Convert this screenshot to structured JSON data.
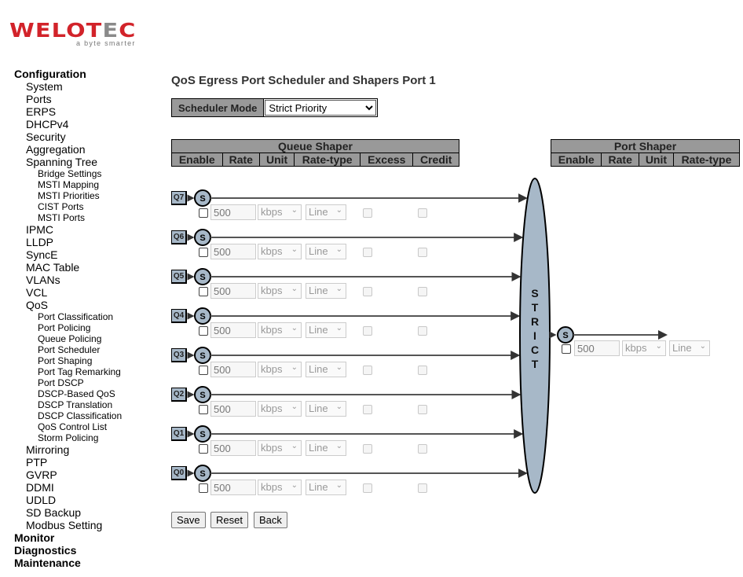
{
  "logo": {
    "brand_main": "WELOT",
    "brand_mid": "E",
    "brand_end": "C",
    "tagline": "a byte smarter"
  },
  "nav": [
    {
      "label": "Configuration",
      "level": 0
    },
    {
      "label": "System",
      "level": 1
    },
    {
      "label": "Ports",
      "level": 1
    },
    {
      "label": "ERPS",
      "level": 1
    },
    {
      "label": "DHCPv4",
      "level": 1
    },
    {
      "label": "Security",
      "level": 1
    },
    {
      "label": "Aggregation",
      "level": 1
    },
    {
      "label": "Spanning Tree",
      "level": 1
    },
    {
      "label": "Bridge Settings",
      "level": 2
    },
    {
      "label": "MSTI Mapping",
      "level": 2
    },
    {
      "label": "MSTI Priorities",
      "level": 2
    },
    {
      "label": "CIST Ports",
      "level": 2
    },
    {
      "label": "MSTI Ports",
      "level": 2
    },
    {
      "label": "IPMC",
      "level": 1
    },
    {
      "label": "LLDP",
      "level": 1
    },
    {
      "label": "SyncE",
      "level": 1
    },
    {
      "label": "MAC Table",
      "level": 1
    },
    {
      "label": "VLANs",
      "level": 1
    },
    {
      "label": "VCL",
      "level": 1
    },
    {
      "label": "QoS",
      "level": 1
    },
    {
      "label": "Port Classification",
      "level": 2
    },
    {
      "label": "Port Policing",
      "level": 2
    },
    {
      "label": "Queue Policing",
      "level": 2
    },
    {
      "label": "Port Scheduler",
      "level": 2
    },
    {
      "label": "Port Shaping",
      "level": 2
    },
    {
      "label": "Port Tag Remarking",
      "level": 2
    },
    {
      "label": "Port DSCP",
      "level": 2
    },
    {
      "label": "DSCP-Based QoS",
      "level": 2
    },
    {
      "label": "DSCP Translation",
      "level": 2
    },
    {
      "label": "DSCP Classification",
      "level": 2
    },
    {
      "label": "QoS Control List",
      "level": 2
    },
    {
      "label": "Storm Policing",
      "level": 2
    },
    {
      "label": "Mirroring",
      "level": 1
    },
    {
      "label": "PTP",
      "level": 1
    },
    {
      "label": "GVRP",
      "level": 1
    },
    {
      "label": "DDMI",
      "level": 1
    },
    {
      "label": "UDLD",
      "level": 1
    },
    {
      "label": "SD Backup",
      "level": 1
    },
    {
      "label": "Modbus Setting",
      "level": 1
    },
    {
      "label": "Monitor",
      "level": 0
    },
    {
      "label": "Diagnostics",
      "level": 0
    },
    {
      "label": "Maintenance",
      "level": 0
    }
  ],
  "page": {
    "title": "QoS Egress Port Scheduler and Shapers Port 1",
    "scheduler_mode_label": "Scheduler Mode",
    "scheduler_mode_value": "Strict Priority"
  },
  "queue_shaper": {
    "title": "Queue Shaper",
    "columns": [
      "Enable",
      "Rate",
      "Unit",
      "Rate-type",
      "Excess",
      "Credit"
    ],
    "queues": [
      {
        "name": "Q7",
        "scheduler": "S",
        "enabled": false,
        "rate": "500",
        "unit": "kbps",
        "rate_type": "Line",
        "excess": false,
        "credit": false
      },
      {
        "name": "Q6",
        "scheduler": "S",
        "enabled": false,
        "rate": "500",
        "unit": "kbps",
        "rate_type": "Line",
        "excess": false,
        "credit": false
      },
      {
        "name": "Q5",
        "scheduler": "S",
        "enabled": false,
        "rate": "500",
        "unit": "kbps",
        "rate_type": "Line",
        "excess": false,
        "credit": false
      },
      {
        "name": "Q4",
        "scheduler": "S",
        "enabled": false,
        "rate": "500",
        "unit": "kbps",
        "rate_type": "Line",
        "excess": false,
        "credit": false
      },
      {
        "name": "Q3",
        "scheduler": "S",
        "enabled": false,
        "rate": "500",
        "unit": "kbps",
        "rate_type": "Line",
        "excess": false,
        "credit": false
      },
      {
        "name": "Q2",
        "scheduler": "S",
        "enabled": false,
        "rate": "500",
        "unit": "kbps",
        "rate_type": "Line",
        "excess": false,
        "credit": false
      },
      {
        "name": "Q1",
        "scheduler": "S",
        "enabled": false,
        "rate": "500",
        "unit": "kbps",
        "rate_type": "Line",
        "excess": false,
        "credit": false
      },
      {
        "name": "Q0",
        "scheduler": "S",
        "enabled": false,
        "rate": "500",
        "unit": "kbps",
        "rate_type": "Line",
        "excess": false,
        "credit": false
      }
    ]
  },
  "strict_label": [
    "S",
    "T",
    "R",
    "I",
    "C",
    "T"
  ],
  "port_shaper": {
    "title": "Port Shaper",
    "columns": [
      "Enable",
      "Rate",
      "Unit",
      "Rate-type"
    ],
    "scheduler": "S",
    "enabled": false,
    "rate": "500",
    "unit": "kbps",
    "rate_type": "Line"
  },
  "buttons": {
    "save": "Save",
    "reset": "Reset",
    "back": "Back"
  },
  "colors": {
    "brand_red": "#d2232a",
    "header_gray": "#999999",
    "node_fill": "#a7b8c8"
  }
}
